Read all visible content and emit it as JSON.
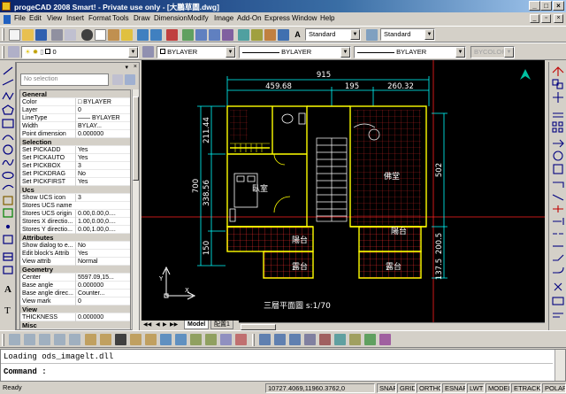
{
  "window": {
    "title": "progeCAD 2008 Smart! - Private use only - [大鵬草圖.dwg]",
    "min": "_",
    "max": "□",
    "close": "×"
  },
  "menu": [
    "File",
    "Edit",
    "View",
    "Insert",
    "Format",
    "Tools",
    "Draw",
    "Dimension",
    "Modify",
    "Image",
    "Add-On",
    "Express",
    "Window",
    "Help"
  ],
  "toolbar": {
    "text_style": "Standard",
    "dim_style": "Standard",
    "layer": "0",
    "color": "BYLAYER",
    "linetype": "BYLAYER",
    "lineweight": "BYLAYER",
    "plotstyle": "BYCOLOR"
  },
  "properties": {
    "selection": "No selection",
    "rows": [
      {
        "k": "General",
        "v": "",
        "cat": true
      },
      {
        "k": "Color",
        "v": "□ BYLAYER"
      },
      {
        "k": "Layer",
        "v": "0"
      },
      {
        "k": "LineType",
        "v": "—— BYLAYER"
      },
      {
        "k": "Width",
        "v": "BYLAY..."
      },
      {
        "k": "Point dimension",
        "v": "0.000000"
      },
      {
        "k": "Selection",
        "v": "",
        "cat": true
      },
      {
        "k": "Set PICKADD",
        "v": "Yes"
      },
      {
        "k": "Set PICKAUTO",
        "v": "Yes"
      },
      {
        "k": "Set PICKBOX",
        "v": "3"
      },
      {
        "k": "Set PICKDRAG",
        "v": "No"
      },
      {
        "k": "Set PICKFIRST",
        "v": "Yes"
      },
      {
        "k": "Ucs",
        "v": "",
        "cat": true
      },
      {
        "k": "Show UCS icon",
        "v": "3"
      },
      {
        "k": "Stores UCS name",
        "v": ""
      },
      {
        "k": "Stores UCS origin",
        "v": "0.00,0.00,0...."
      },
      {
        "k": "Stores X directio...",
        "v": "1.00,0.00,0...."
      },
      {
        "k": "Stores Y directio...",
        "v": "0.00,1.00,0...."
      },
      {
        "k": "Attributes",
        "v": "",
        "cat": true
      },
      {
        "k": "Show dialog to e...",
        "v": "No"
      },
      {
        "k": "Edit block's Attrib",
        "v": "Yes"
      },
      {
        "k": "View attrib",
        "v": "Normal"
      },
      {
        "k": "Geometry",
        "v": "",
        "cat": true
      },
      {
        "k": "Center",
        "v": "5597.09,15..."
      },
      {
        "k": "Base angle",
        "v": "0.000000"
      },
      {
        "k": "Base angle direc...",
        "v": "Counter..."
      },
      {
        "k": "View mark",
        "v": "0"
      },
      {
        "k": "View",
        "v": "",
        "cat": true
      },
      {
        "k": "THICKNESS",
        "v": "0.000000"
      },
      {
        "k": "Misc",
        "v": "",
        "cat": true
      }
    ]
  },
  "drawing": {
    "dims_top": [
      "915",
      "459.68",
      "195",
      "260.32"
    ],
    "dims_left": [
      "700",
      "211.44",
      "338.56",
      "150"
    ],
    "dims_right": [
      "502",
      "200.5",
      "137.5"
    ],
    "rooms": [
      "臥室",
      "佛堂",
      "陽台",
      "陽台",
      "露台",
      "露台"
    ],
    "plan_title": "三層平面圖 s:1/70"
  },
  "layout_tabs": [
    "Model",
    "配置1"
  ],
  "command": {
    "history": "Loading ods_imagelt.dll",
    "prompt": "Command :"
  },
  "status": {
    "ready": "Ready",
    "coords": "10727.4069,11960.3762,0",
    "toggles": [
      "SNAP",
      "GRID",
      "ORTHO",
      "ESNAP",
      "LWT",
      "MODEL",
      "ETRACK",
      "POLAR"
    ]
  },
  "colors": {
    "canvas": "#000000",
    "walls": "#ffff00",
    "dims": "#00ffff",
    "hatch": "#ff4040",
    "stairs": "#ffffff"
  }
}
